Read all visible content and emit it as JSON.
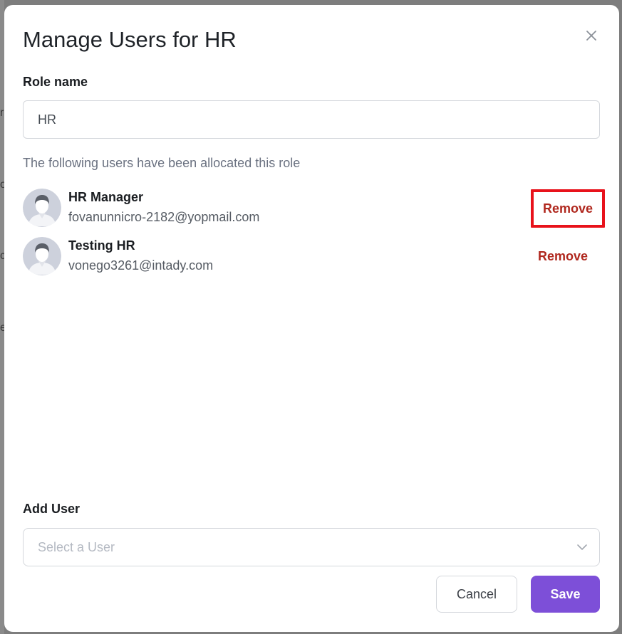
{
  "modal": {
    "title": "Manage Users for HR",
    "role_name_label": "Role name",
    "role_name_value": "HR",
    "allocated_text": "The following users have been allocated this role",
    "users": [
      {
        "name": "HR Manager",
        "email": "fovanunnicro-2182@yopmail.com",
        "remove_label": "Remove"
      },
      {
        "name": "Testing HR",
        "email": "vonego3261@intady.com",
        "remove_label": "Remove"
      }
    ],
    "add_user_label": "Add User",
    "select_placeholder": "Select a User",
    "cancel_label": "Cancel",
    "save_label": "Save"
  },
  "background_fragments": [
    "r",
    "o",
    "c",
    "e"
  ],
  "icons": {
    "close": "close-icon",
    "chevron": "chevron-down-icon",
    "avatar": "user-avatar-icon"
  },
  "colors": {
    "accent": "#7d4fd8",
    "danger": "#b0281e",
    "highlight": "#e8121b"
  }
}
